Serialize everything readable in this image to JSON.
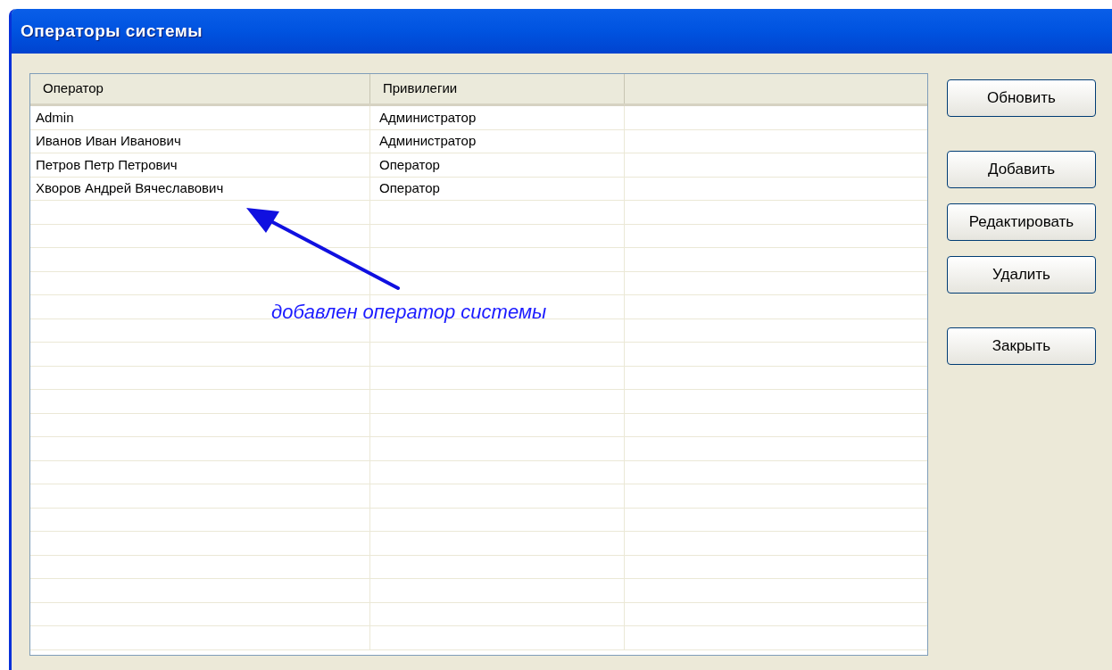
{
  "window": {
    "title": "Операторы системы"
  },
  "table": {
    "columns": [
      "Оператор",
      "Привилегии"
    ],
    "rows": [
      {
        "operator": "Admin",
        "privileges": "Администратор"
      },
      {
        "operator": "Иванов Иван Иванович",
        "privileges": "Администратор"
      },
      {
        "operator": "Петров Петр Петрович",
        "privileges": "Оператор"
      },
      {
        "operator": "Хворов Андрей Вячеславович",
        "privileges": "Оператор"
      }
    ]
  },
  "button_groups": [
    [
      "Обновить"
    ],
    [
      "Добавить",
      "Редактировать",
      "Удалить"
    ],
    [
      "Закрыть"
    ]
  ],
  "annotation": {
    "text": "добавлен оператор системы"
  }
}
